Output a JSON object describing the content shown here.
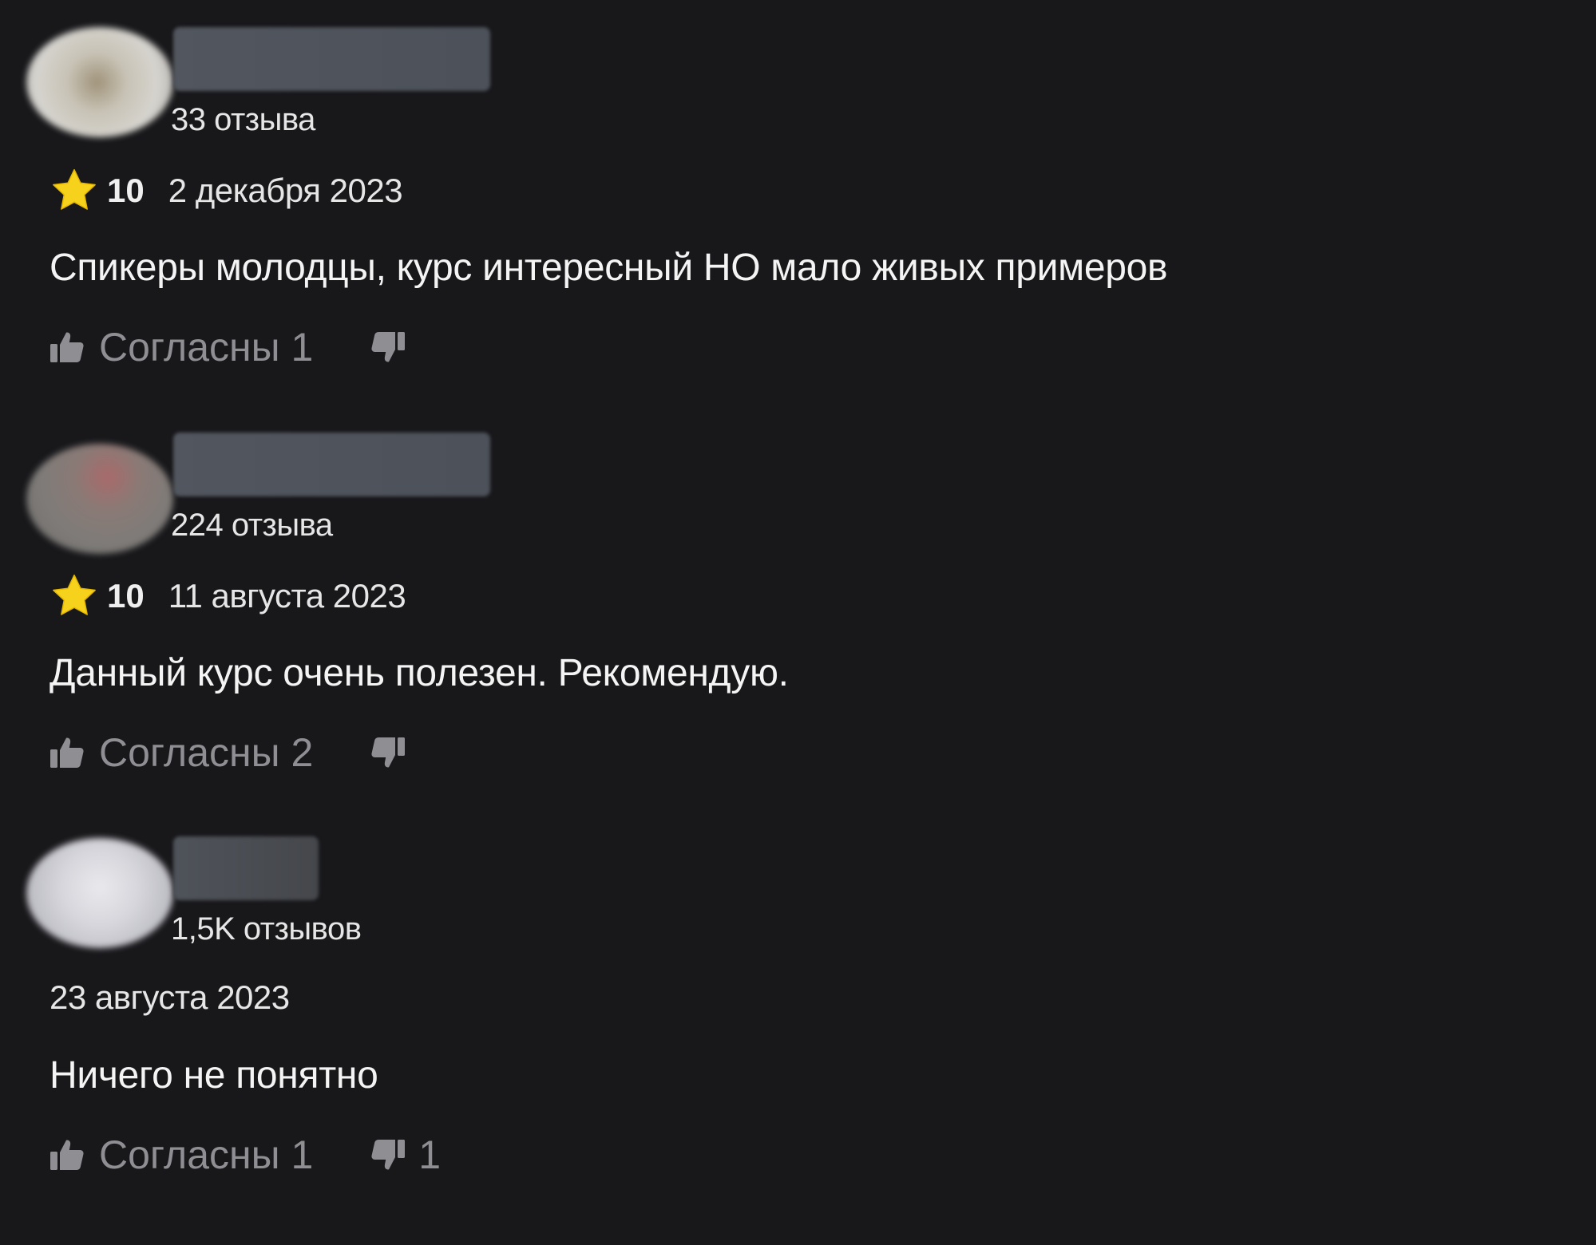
{
  "colors": {
    "background": "#18181b",
    "star": "#f7d21c",
    "muted": "#8e8e93",
    "text": "#f2f2f2"
  },
  "reviews": [
    {
      "review_count": "33 отзыва",
      "rating": "10",
      "date": "2 декабря 2023",
      "text": "Спикеры молодцы, курс интересный НО мало живых примеров",
      "like_label": "Согласны 1",
      "dislike_count": ""
    },
    {
      "review_count": "224 отзыва",
      "rating": "10",
      "date": "11 августа 2023",
      "text": "Данный курс очень полезен. Рекомендую.",
      "like_label": "Согласны 2",
      "dislike_count": ""
    },
    {
      "review_count": "1,5K отзывов",
      "rating": "",
      "date": "23 августа 2023",
      "text": "Ничего не понятно",
      "like_label": "Согласны 1",
      "dislike_count": "1"
    }
  ]
}
